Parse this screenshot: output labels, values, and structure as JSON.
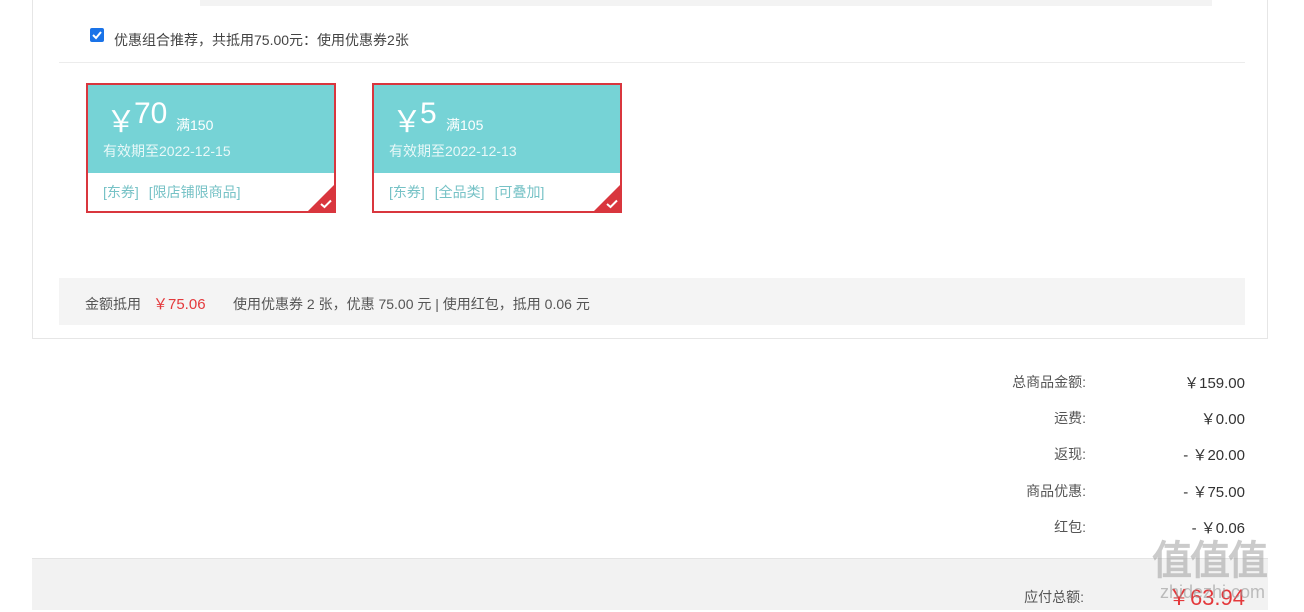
{
  "combo": {
    "checked": true,
    "text": "优惠组合推荐，共抵用75.00元：使用优惠券2张"
  },
  "coupons": [
    {
      "currency": "￥",
      "amount": "70",
      "condition": "满150",
      "validity": "有效期至2022-12-15",
      "tags": [
        "[东券]",
        "[限店铺限商品]"
      ],
      "selected": true
    },
    {
      "currency": "￥",
      "amount": "5",
      "condition": "满105",
      "validity": "有效期至2022-12-13",
      "tags": [
        "[东券]",
        "[全品类]",
        "[可叠加]"
      ],
      "selected": true
    }
  ],
  "summary": {
    "label": "金额抵用",
    "amount": "￥75.06",
    "description": "使用优惠券 2 张，优惠 75.00 元  | 使用红包，抵用 0.06 元"
  },
  "totals": [
    {
      "label": "总商品金额:",
      "value": "￥159.00"
    },
    {
      "label": "运费:",
      "value": "￥0.00"
    },
    {
      "label": "返现:",
      "value": "- ￥20.00"
    },
    {
      "label": "商品优惠:",
      "value": "- ￥75.00"
    },
    {
      "label": "红包:",
      "value": "- ￥0.06"
    }
  ],
  "payable": {
    "label": "应付总额:",
    "value": "￥63.94"
  },
  "watermark": {
    "text": "值值值",
    "sub": "zhidezhi.com"
  },
  "colors": {
    "accent_red": "#e4393c",
    "coupon_teal": "#76d3d6",
    "checkbox_blue": "#1a73e8"
  }
}
